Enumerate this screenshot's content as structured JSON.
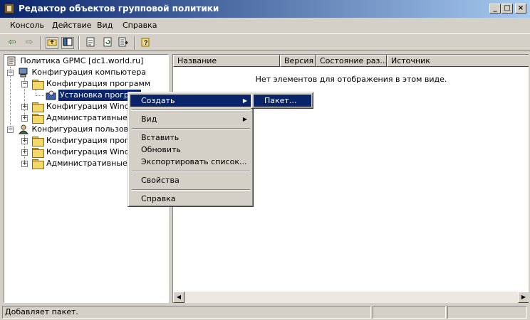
{
  "window": {
    "title": "Редактор объектов групповой политики",
    "controls": {
      "minimize": "_",
      "maximize": "□",
      "close": "×"
    }
  },
  "menubar": [
    {
      "label": "Консоль"
    },
    {
      "label": "Действие"
    },
    {
      "label": "Вид"
    },
    {
      "label": "Справка"
    }
  ],
  "toolbar": {
    "icons": [
      "back-arrow-icon",
      "forward-arrow-icon",
      "up-folder-icon",
      "show-hide-tree-icon",
      "properties-icon",
      "refresh-icon",
      "export-list-icon",
      "help-icon"
    ]
  },
  "tree": {
    "root": "Политика GPMC [dc1.world.ru]",
    "computer_config": "Конфигурация компьютера",
    "computer_software": "Конфигурация программ",
    "software_install": "Установка програм",
    "computer_windows": "Конфигурация Windov",
    "computer_admin": "Административные ша",
    "user_config": "Конфигурация пользовате",
    "user_software": "Конфигурация програм",
    "user_windows": "Конфигурация Window",
    "user_admin": "Административные ша"
  },
  "list": {
    "columns": [
      "Название",
      "Версия",
      "Состояние раз...",
      "Источник"
    ],
    "empty_message": "Нет элементов для отображения в этом виде."
  },
  "context_menu": {
    "create": "Создать",
    "view": "Вид",
    "paste": "Вставить",
    "refresh": "Обновить",
    "export": "Экспортировать список...",
    "properties": "Свойства",
    "help": "Справка"
  },
  "submenu": {
    "package": "Пакет..."
  },
  "status": {
    "text": "Добавляет пакет."
  },
  "colors": {
    "selection": "#0a246a",
    "face": "#d4d0c8"
  }
}
